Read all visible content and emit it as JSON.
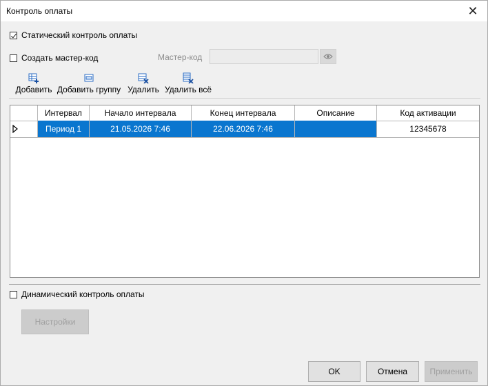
{
  "window": {
    "title": "Контроль оплаты"
  },
  "static_control": {
    "label": "Статический контроль оплаты",
    "checked": true
  },
  "master_code": {
    "create_label": "Создать мастер-код",
    "create_checked": false,
    "field_label": "Мастер-код",
    "value": ""
  },
  "toolbar": {
    "add": "Добавить",
    "add_group": "Добавить группу",
    "delete": "Удалить",
    "delete_all": "Удалить всё"
  },
  "table": {
    "columns": [
      "Интервал",
      "Начало интервала",
      "Конец интервала",
      "Описание",
      "Код активации"
    ],
    "rows": [
      {
        "interval": "Период 1",
        "start": "21.05.2026 7:46",
        "end": "22.06.2026 7:46",
        "description": "",
        "code": "12345678"
      }
    ]
  },
  "dynamic_control": {
    "label": "Динамический контроль оплаты",
    "checked": false
  },
  "buttons": {
    "settings": "Настройки",
    "ok": "OK",
    "cancel": "Отмена",
    "apply": "Применить"
  },
  "colors": {
    "selection": "#0a76cf",
    "icon_blue": "#2b6cc4"
  }
}
